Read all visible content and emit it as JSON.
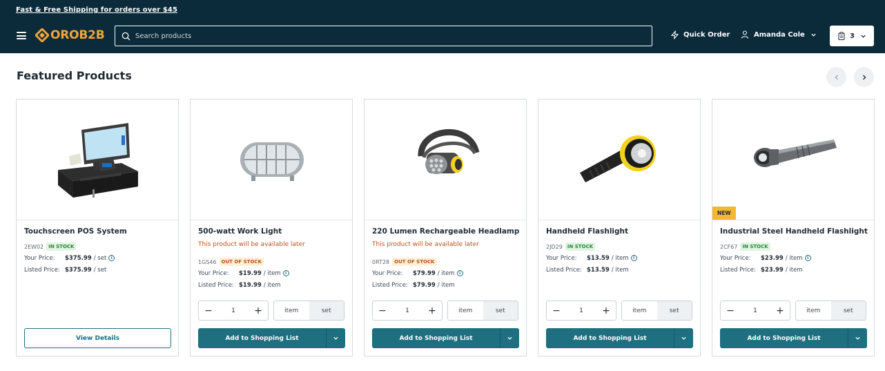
{
  "header": {
    "promo": "Fast & Free Shipping for orders over $45",
    "logo": "OROB2B",
    "search_placeholder": "Search products",
    "quick_order": "Quick Order",
    "user_name": "Amanda Cole",
    "cart_count": "3"
  },
  "colors": {
    "header_bg": "#0b2a3a",
    "accent": "#1e6f80",
    "logo": "#f0a53a",
    "new_badge": "#f5b731"
  },
  "section": {
    "title": "Featured Products"
  },
  "products": [
    {
      "name": "Touchscreen POS System",
      "sku": "2EW02",
      "stock": "IN STOCK",
      "your_price_label": "Your Price:",
      "your_price": "$375.99",
      "your_unit": "/ set",
      "listed_price_label": "Listed Price:",
      "listed_price": "$375.99",
      "listed_unit": "/ set",
      "action": "View Details"
    },
    {
      "name": "500-watt Work Light",
      "availability": "This product will be available later",
      "sku": "1GS46",
      "stock": "OUT OF STOCK",
      "your_price_label": "Your Price:",
      "your_price": "$19.99",
      "your_unit": "/ item",
      "listed_price_label": "Listed Price:",
      "listed_price": "$19.99",
      "listed_unit": "/ item",
      "qty": "1",
      "unit_selected": "item",
      "unit_other": "set",
      "action": "Add to Shopping List"
    },
    {
      "name": "220 Lumen Rechargeable Headlamp",
      "availability": "This product will be available later",
      "sku": "0RT28",
      "stock": "OUT OF STOCK",
      "your_price_label": "Your Price:",
      "your_price": "$79.99",
      "your_unit": "/ item",
      "listed_price_label": "Listed Price:",
      "listed_price": "$79.99",
      "listed_unit": "/ item",
      "qty": "1",
      "unit_selected": "item",
      "unit_other": "set",
      "action": "Add to Shopping List"
    },
    {
      "name": "Handheld Flashlight",
      "sku": "2JD29",
      "stock": "IN STOCK",
      "your_price_label": "Your Price:",
      "your_price": "$13.59",
      "your_unit": "/ item",
      "listed_price_label": "Listed Price:",
      "listed_price": "$13.59",
      "listed_unit": "/ item",
      "qty": "1",
      "unit_selected": "item",
      "unit_other": "set",
      "action": "Add to Shopping List"
    },
    {
      "name": "Industrial Steel Handheld Flashlight",
      "badge": "NEW",
      "sku": "2CF67",
      "stock": "IN STOCK",
      "your_price_label": "Your Price:",
      "your_price": "$23.99",
      "your_unit": "/ item",
      "listed_price_label": "Listed Price:",
      "listed_price": "$23.99",
      "listed_unit": "/ item",
      "qty": "1",
      "unit_selected": "item",
      "unit_other": "set",
      "action": "Add to Shopping List"
    }
  ]
}
